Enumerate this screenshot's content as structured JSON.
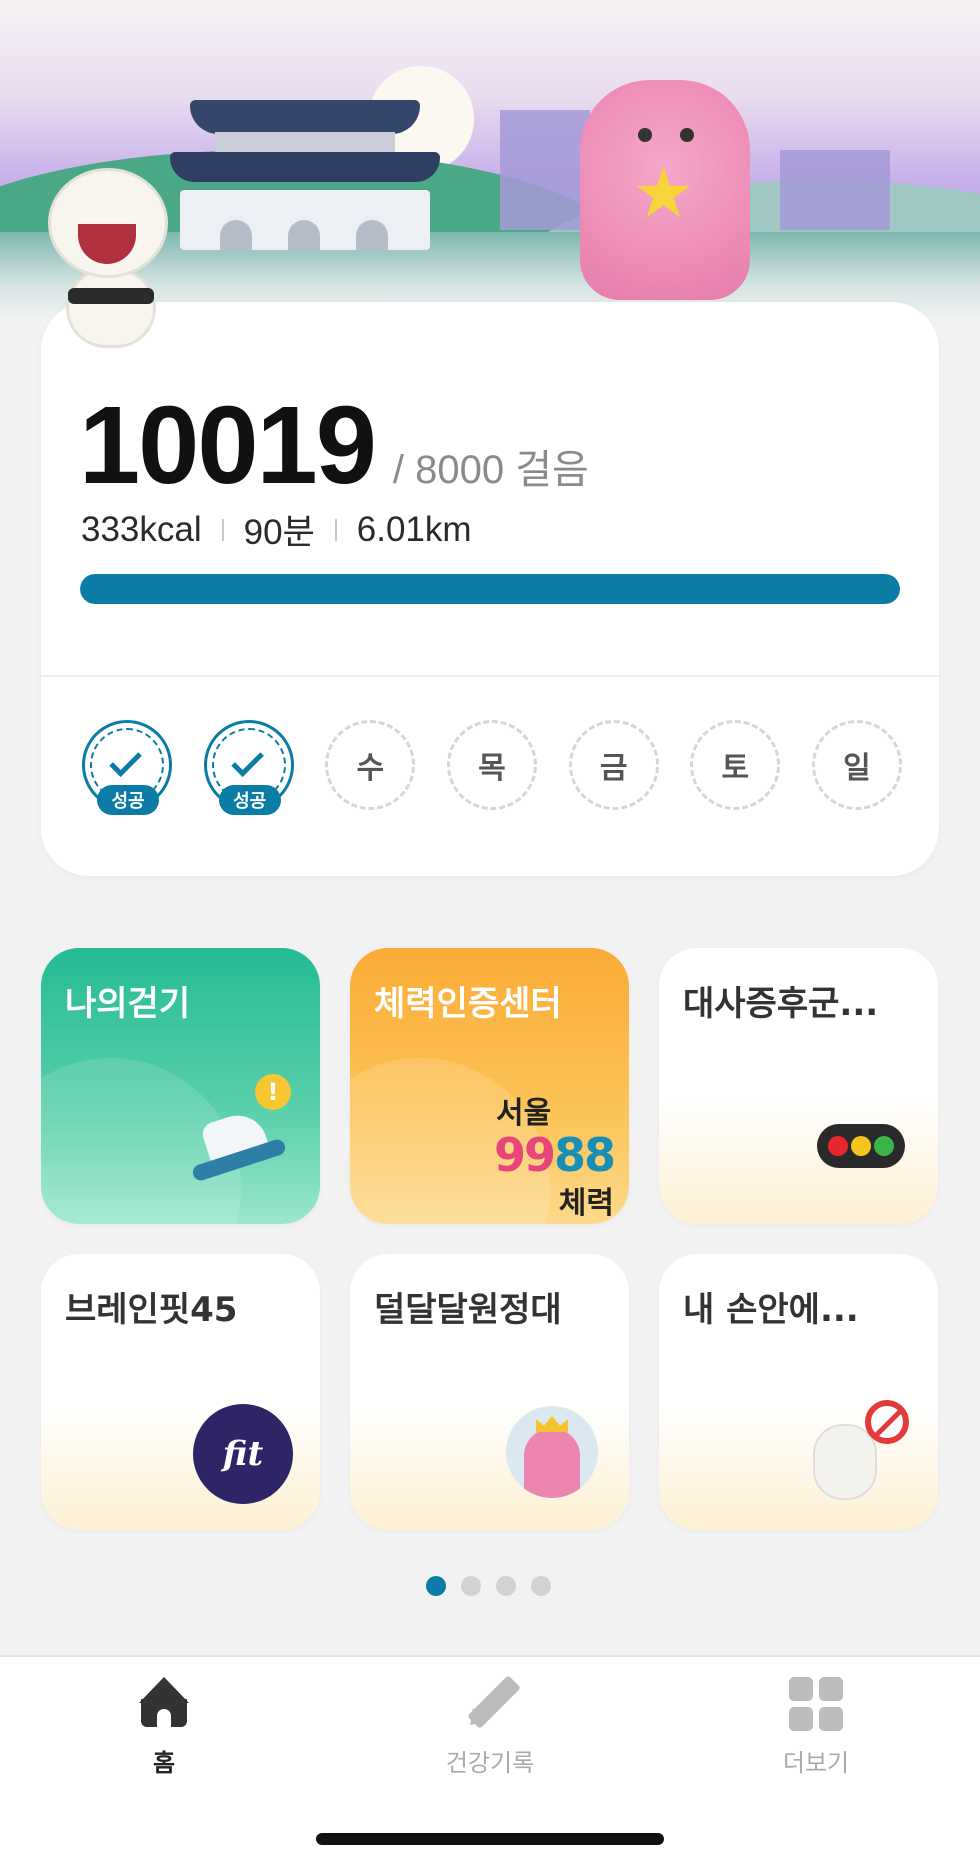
{
  "steps": {
    "count": "10019",
    "goal": "/ 8000 걸음",
    "kcal": "333kcal",
    "minutes": "90분",
    "distance": "6.01km",
    "progress_fraction": 1.0
  },
  "week": [
    {
      "label": "",
      "status": "success",
      "badge": "성공"
    },
    {
      "label": "",
      "status": "success",
      "badge": "성공"
    },
    {
      "label": "수",
      "status": "pending",
      "badge": ""
    },
    {
      "label": "목",
      "status": "pending",
      "badge": ""
    },
    {
      "label": "금",
      "status": "pending",
      "badge": ""
    },
    {
      "label": "토",
      "status": "pending",
      "badge": ""
    },
    {
      "label": "일",
      "status": "pending",
      "badge": ""
    }
  ],
  "tiles": [
    {
      "label": "나의걷기",
      "icon": "walking-shoe-icon"
    },
    {
      "label": "체력인증센터",
      "icon": "seoul-9988-logo",
      "logo_line1": "서울",
      "logo_digits_pink": "99",
      "logo_digits_blue": "88",
      "logo_line3": "체력"
    },
    {
      "label": "대사증후군...",
      "icon": "traffic-light-icon"
    },
    {
      "label": "브레인핏45",
      "icon": "brainfit-logo",
      "logo_text": "fit"
    },
    {
      "label": "덜달달원정대",
      "icon": "pink-mascot-icon"
    },
    {
      "label": "내 손안에...",
      "icon": "no-smoking-mascot-icon"
    }
  ],
  "pager": {
    "total": 4,
    "active": 0
  },
  "nav": {
    "home": "홈",
    "health_record": "건강기록",
    "more": "더보기"
  },
  "colors": {
    "accent": "#0b7ca6",
    "tile_green": "#24bb95",
    "tile_orange": "#fbab36"
  }
}
